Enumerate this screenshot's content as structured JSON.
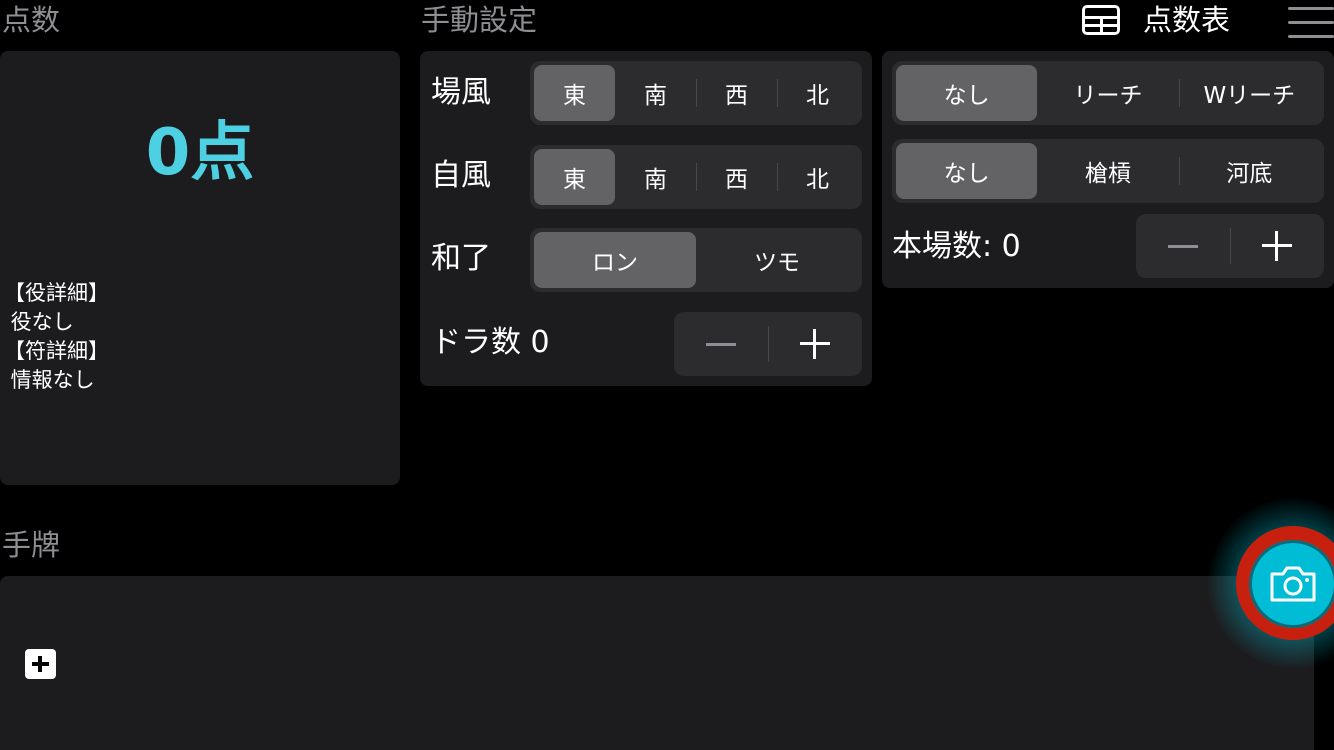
{
  "score": {
    "section_title": "点数",
    "value": "0",
    "unit": "点",
    "detail_text": "【役詳細】\n 役なし\n【符詳細】\n 情報なし"
  },
  "manual": {
    "section_title": "手動設定",
    "round_wind": {
      "label": "場風",
      "options": [
        "東",
        "南",
        "西",
        "北"
      ],
      "selected": "東"
    },
    "seat_wind": {
      "label": "自風",
      "options": [
        "東",
        "南",
        "西",
        "北"
      ],
      "selected": "東"
    },
    "win_type": {
      "label": "和了",
      "options": [
        "ロン",
        "ツモ"
      ],
      "selected": "ロン"
    },
    "dora": {
      "label": "ドラ数",
      "value": "0"
    }
  },
  "extras": {
    "riichi": {
      "options": [
        "なし",
        "リーチ",
        "Wリーチ"
      ],
      "selected": "なし"
    },
    "special": {
      "options": [
        "なし",
        "槍槓",
        "河底"
      ],
      "selected": "なし"
    },
    "honba": {
      "label": "本場数:",
      "value": "0"
    }
  },
  "header": {
    "score_table_label": "点数表",
    "table_icon": "table-grid-icon",
    "menu_icon": "hamburger-menu-icon"
  },
  "hand": {
    "section_title": "手牌",
    "add_icon": "plus-square-icon"
  },
  "fab": {
    "icon": "camera-icon",
    "colors": {
      "fill": "#00bcd4",
      "ring": "#c8200e"
    }
  },
  "colors": {
    "accent": "#4dd0e1",
    "panel": "#1c1c1e",
    "control": "#2c2c2e",
    "selected": "#636366"
  }
}
